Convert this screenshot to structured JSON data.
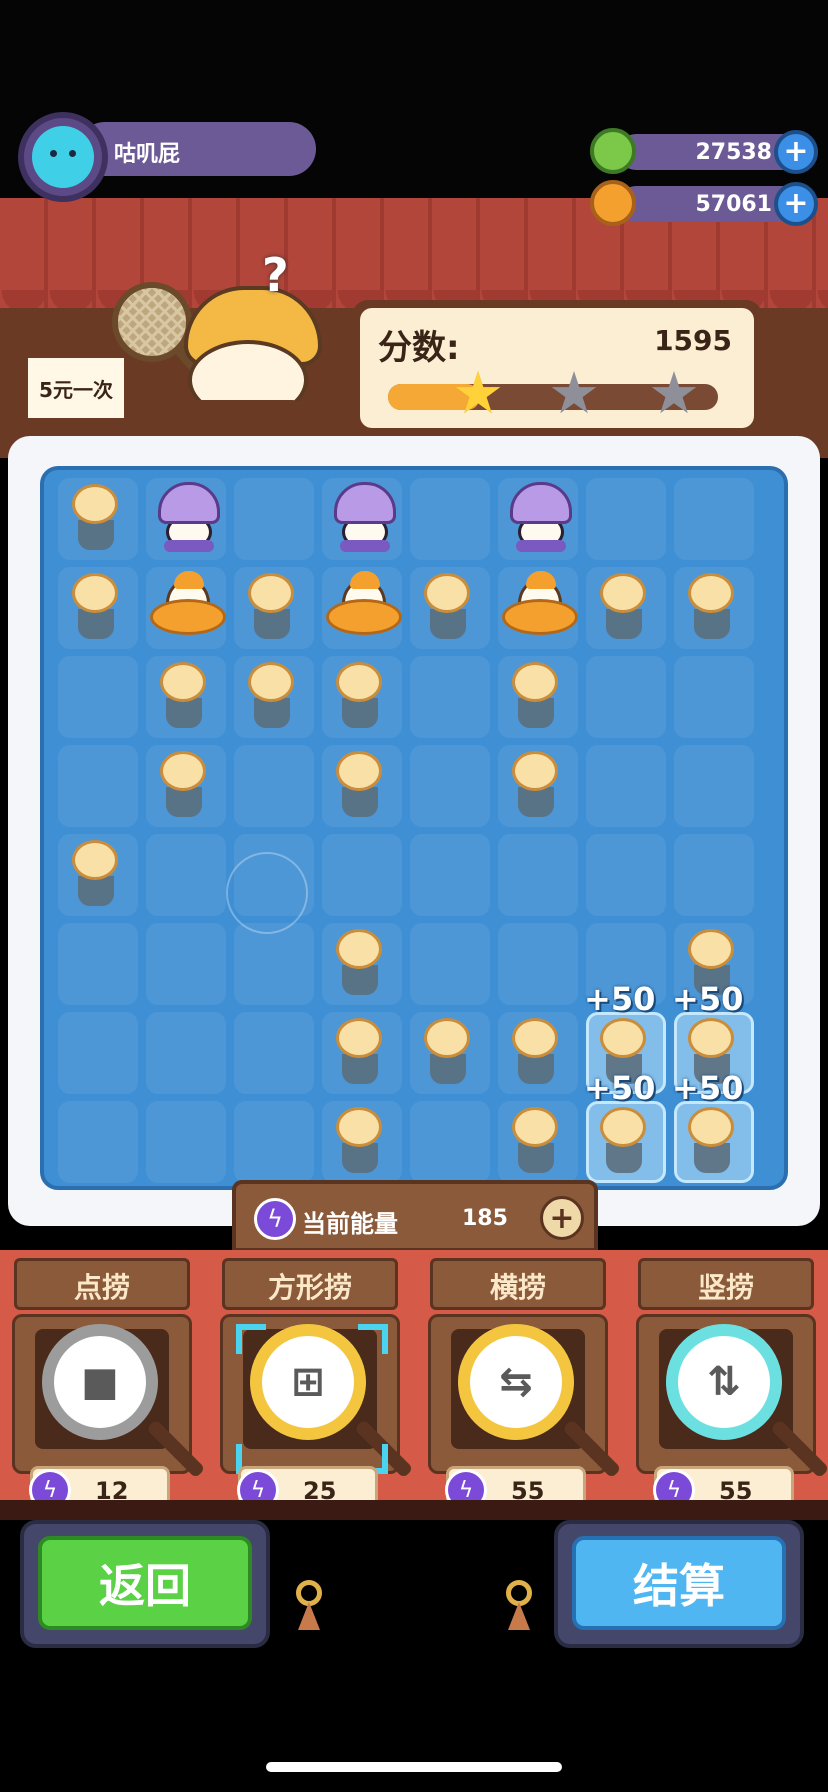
{
  "player": {
    "name": "咕叽屁",
    "avatar_icon": "cat-avatar-icon"
  },
  "currencies": [
    {
      "icon": "donut-coin-icon",
      "value": "27538",
      "color": "#7cc94a"
    },
    {
      "icon": "planet-gem-icon",
      "value": "57061",
      "color": "#f4a02e"
    }
  ],
  "shop_sign": "5元一次",
  "score": {
    "label": "分数:",
    "value": "1595",
    "progress": 0.28,
    "stars_earned": 1,
    "stars_total": 3
  },
  "board": {
    "cols": 8,
    "rows": 8,
    "pieces": [
      {
        "r": 0,
        "c": 0,
        "t": "fish"
      },
      {
        "r": 0,
        "c": 1,
        "t": "penguin"
      },
      {
        "r": 0,
        "c": 3,
        "t": "penguin"
      },
      {
        "r": 0,
        "c": 5,
        "t": "penguin"
      },
      {
        "r": 1,
        "c": 0,
        "t": "fish"
      },
      {
        "r": 1,
        "c": 1,
        "t": "duck"
      },
      {
        "r": 1,
        "c": 2,
        "t": "fish"
      },
      {
        "r": 1,
        "c": 3,
        "t": "duck"
      },
      {
        "r": 1,
        "c": 4,
        "t": "fish"
      },
      {
        "r": 1,
        "c": 5,
        "t": "duck"
      },
      {
        "r": 1,
        "c": 6,
        "t": "fish"
      },
      {
        "r": 1,
        "c": 7,
        "t": "fish"
      },
      {
        "r": 2,
        "c": 1,
        "t": "fish"
      },
      {
        "r": 2,
        "c": 2,
        "t": "fish"
      },
      {
        "r": 2,
        "c": 3,
        "t": "fish"
      },
      {
        "r": 2,
        "c": 5,
        "t": "fish"
      },
      {
        "r": 3,
        "c": 1,
        "t": "fish"
      },
      {
        "r": 3,
        "c": 3,
        "t": "fish"
      },
      {
        "r": 3,
        "c": 5,
        "t": "fish"
      },
      {
        "r": 4,
        "c": 0,
        "t": "fish"
      },
      {
        "r": 5,
        "c": 3,
        "t": "fish"
      },
      {
        "r": 5,
        "c": 7,
        "t": "fish"
      },
      {
        "r": 6,
        "c": 3,
        "t": "fish"
      },
      {
        "r": 6,
        "c": 4,
        "t": "fish"
      },
      {
        "r": 6,
        "c": 5,
        "t": "fish"
      },
      {
        "r": 6,
        "c": 6,
        "t": "fish"
      },
      {
        "r": 6,
        "c": 7,
        "t": "fish"
      },
      {
        "r": 7,
        "c": 3,
        "t": "fish"
      },
      {
        "r": 7,
        "c": 5,
        "t": "fish"
      },
      {
        "r": 7,
        "c": 6,
        "t": "fish"
      },
      {
        "r": 7,
        "c": 7,
        "t": "fish"
      }
    ],
    "highlighted": [
      {
        "r": 6,
        "c": 6
      },
      {
        "r": 6,
        "c": 7
      },
      {
        "r": 7,
        "c": 6
      },
      {
        "r": 7,
        "c": 7
      }
    ],
    "bonus_labels": [
      {
        "r": 6,
        "c": 6,
        "text": "+50"
      },
      {
        "r": 6,
        "c": 7,
        "text": "+50"
      },
      {
        "r": 7,
        "c": 6,
        "text": "+50"
      },
      {
        "r": 7,
        "c": 7,
        "text": "+50"
      }
    ]
  },
  "energy": {
    "label": "当前能量",
    "value": "185",
    "icon": "lightning-icon"
  },
  "tools": [
    {
      "id": "point",
      "title": "点捞",
      "cost": "12",
      "icon": "square-icon",
      "lens": "silver",
      "selected": false
    },
    {
      "id": "square",
      "title": "方形捞",
      "cost": "25",
      "icon": "four-squares-icon",
      "lens": "gold",
      "selected": true
    },
    {
      "id": "horizontal",
      "title": "横捞",
      "cost": "55",
      "icon": "left-right-arrows-icon",
      "lens": "gold",
      "selected": false
    },
    {
      "id": "vertical",
      "title": "竖捞",
      "cost": "55",
      "icon": "up-down-arrows-icon",
      "lens": "teal",
      "selected": false
    }
  ],
  "buttons": {
    "back": "返回",
    "settle": "结算"
  }
}
